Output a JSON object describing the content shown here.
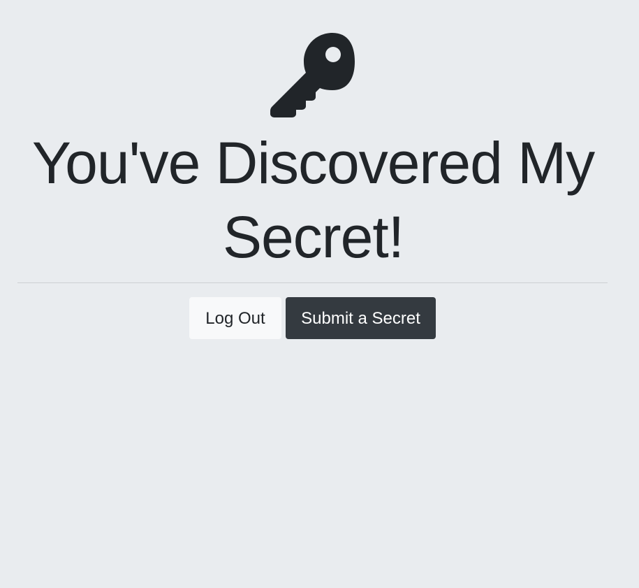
{
  "page": {
    "icon": "key-icon",
    "title": "You've Discovered My Secret!",
    "buttons": {
      "logout_label": "Log Out",
      "submit_label": "Submit a Secret"
    }
  },
  "colors": {
    "background": "#e9ecef",
    "text": "#212529",
    "button_light": "#f8f9fa",
    "button_dark": "#343a40"
  }
}
